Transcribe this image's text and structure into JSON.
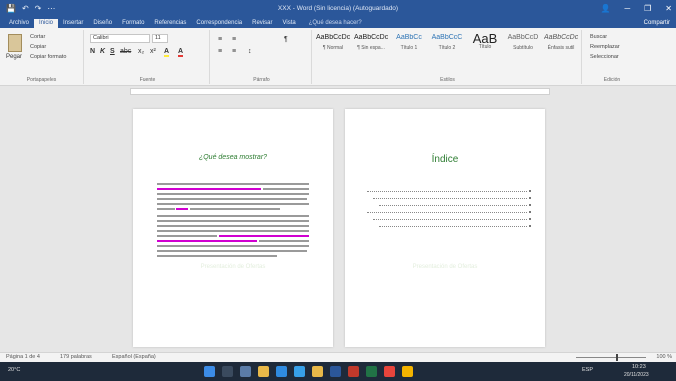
{
  "titlebar": {
    "doc_title": "XXX - Word (Sin licencia) (Autoguardado)",
    "quick_access": [
      "💾",
      "↶",
      "↷",
      "⋯"
    ],
    "controls": [
      "👤",
      "─",
      "❐",
      "✕"
    ]
  },
  "tabs": {
    "items": [
      "Archivo",
      "Inicio",
      "Insertar",
      "Diseño",
      "Formato",
      "Referencias",
      "Correspondencia",
      "Revisar",
      "Vista"
    ],
    "active_index": 1,
    "tell_me": "¿Qué desea hacer?",
    "share": "Compartir"
  },
  "ribbon": {
    "clipboard": {
      "paste": "Pegar",
      "items": [
        "Cortar",
        "Copiar",
        "Copiar formato"
      ],
      "label": "Portapapeles"
    },
    "font": {
      "name": "Calibri",
      "size": "11",
      "label": "Fuente",
      "buttons": [
        "N",
        "K",
        "S",
        "abc",
        "x₂",
        "x²",
        "A",
        "A"
      ]
    },
    "paragraph": {
      "label": "Párrafo",
      "buttons": [
        "≡",
        "≡",
        "≡",
        "≡",
        "¶",
        "↕"
      ]
    },
    "styles": {
      "label": "Estilos",
      "tiles": [
        {
          "preview": "AaBbCcDc",
          "name": "¶ Normal"
        },
        {
          "preview": "AaBbCcDc",
          "name": "¶ Sin espa..."
        },
        {
          "preview": "AaBbCc",
          "name": "Título 1"
        },
        {
          "preview": "AaBbCcC",
          "name": "Título 2"
        },
        {
          "preview": "AaB",
          "name": "Título"
        },
        {
          "preview": "AaBbCcD",
          "name": "Subtítulo"
        },
        {
          "preview": "AaBbCcDc",
          "name": "Énfasis sutil"
        }
      ]
    },
    "editing": {
      "label": "Edición",
      "items": [
        "Buscar",
        "Reemplazar",
        "Seleccionar"
      ]
    }
  },
  "document": {
    "page1_title": "¿Qué desea mostrar?",
    "page2_title": "Índice",
    "watermark": "Presentación de Ofertas"
  },
  "statusbar": {
    "page": "Página 1 de 4",
    "words": "179 palabras",
    "language": "Español (España)",
    "zoom": "100 %"
  },
  "taskbar": {
    "weather": "20°C",
    "time": "10:23",
    "date": "20/11/2023",
    "lang": "ESP"
  },
  "colors": {
    "accent": "#2b579a",
    "heading": "#2e7d32",
    "highlight": "#d100d1"
  }
}
